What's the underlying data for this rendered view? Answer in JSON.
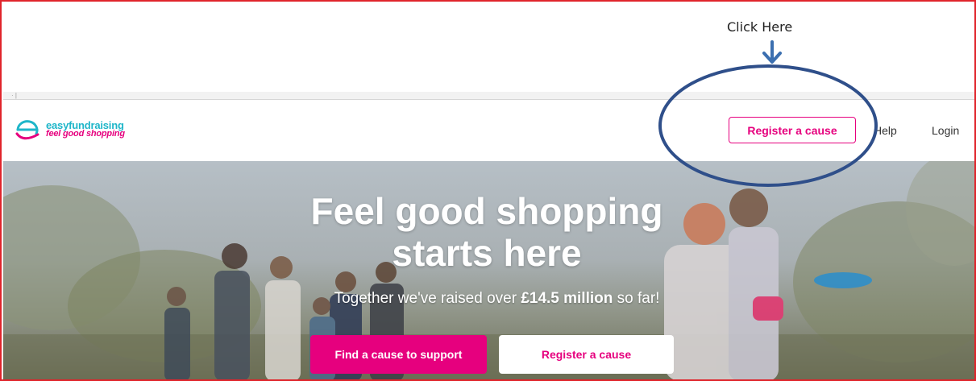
{
  "annotation": {
    "callout_text": "Click Here"
  },
  "header": {
    "logo_name": "easyfundraising",
    "logo_tagline": "feel good shopping",
    "register_label": "Register a cause",
    "help_label": "Help",
    "login_label": "Login"
  },
  "hero": {
    "title_line1": "Feel good shopping",
    "title_line2": "starts here",
    "subtitle_prefix": "Together we've raised over ",
    "subtitle_amount": "£14.5 million",
    "subtitle_suffix": " so far!",
    "primary_button": "Find a cause to support",
    "secondary_button": "Register a cause"
  },
  "colors": {
    "brand_pink": "#e6007e",
    "brand_teal": "#1fb6c9",
    "annotation_blue": "#2f4f8a",
    "frame_red": "#e0242b"
  }
}
